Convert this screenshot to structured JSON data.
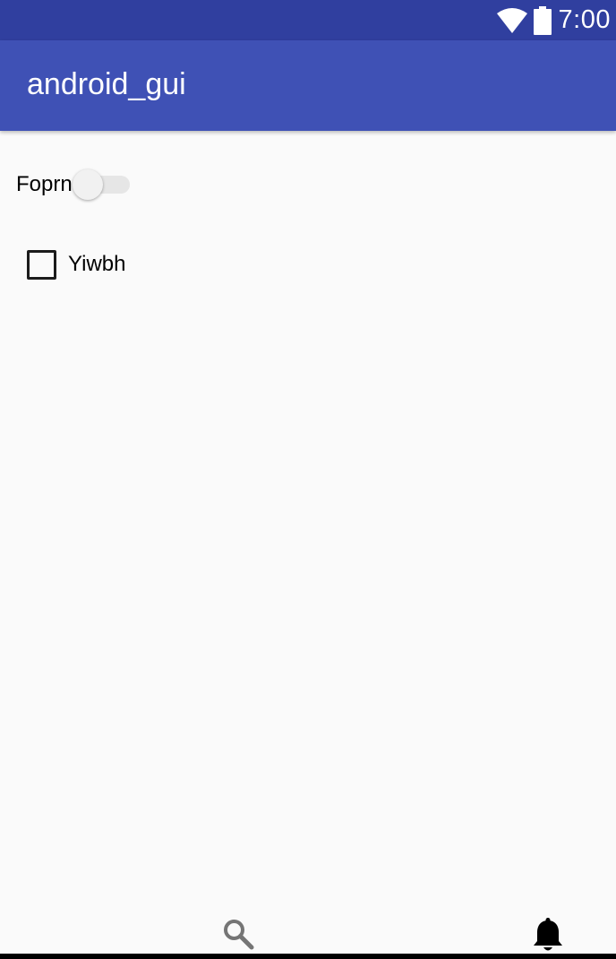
{
  "status_bar": {
    "time": "7:00",
    "icons": [
      "wifi-icon",
      "battery-icon"
    ],
    "background": "#303f9f"
  },
  "app_bar": {
    "title": "android_gui",
    "background": "#3f51b5"
  },
  "main": {
    "switch": {
      "label": "Foprn",
      "checked": false
    },
    "checkbox": {
      "label": "Yiwbh",
      "checked": false
    }
  },
  "bottom_nav": {
    "items": [
      {
        "icon": "search-icon"
      },
      {
        "icon": "bell-icon"
      }
    ]
  }
}
